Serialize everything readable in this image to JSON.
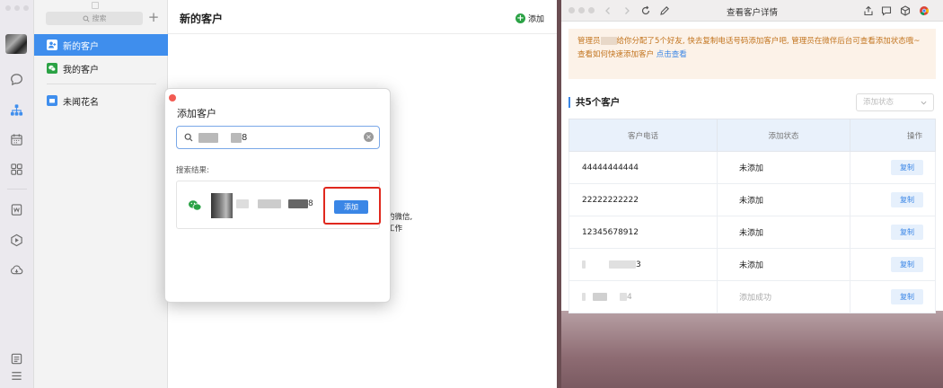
{
  "left_app": {
    "search": {
      "placeholder": "搜索"
    },
    "contact_list": {
      "items": [
        {
          "label": "新的客户",
          "active": true
        },
        {
          "label": "我的客户",
          "active": false
        },
        {
          "label": "未闻花名",
          "active": false
        }
      ]
    },
    "main": {
      "title": "新的客户",
      "add_label": "添加",
      "hint_line1": "的微信,",
      "hint_line2": "工作"
    },
    "dialog": {
      "title": "添加客户",
      "search_value_suffix": "8",
      "results_label": "搜索结果:",
      "result": {
        "name_suffix": "8"
      },
      "add_button": "添加"
    }
  },
  "right_app": {
    "title": "查看客户详情",
    "notice": {
      "line1_prefix": "管理员",
      "line1_rest": "给你分配了5个好友, 快去复制电话号码添加客户吧, 管理员在微伴后台可查看添加状态哦~",
      "line2": "查看如何快速添加客户",
      "link": "点击查看"
    },
    "count_title": "共5个客户",
    "status_select": {
      "placeholder": "添加状态"
    },
    "table": {
      "headers": [
        "客户电话",
        "添加状态",
        "操作"
      ],
      "rows": [
        {
          "phone": "44444444444",
          "status": "未添加",
          "action": "复制",
          "faded": false
        },
        {
          "phone": "22222222222",
          "status": "未添加",
          "action": "复制",
          "faded": false
        },
        {
          "phone": "12345678912",
          "status": "未添加",
          "action": "复制",
          "faded": false
        },
        {
          "phone_suffix": "3",
          "status": "未添加",
          "action": "复制",
          "faded": false
        },
        {
          "phone_suffix": "4",
          "status": "添加成功",
          "action": "复制",
          "faded": true
        }
      ]
    }
  },
  "colors": {
    "accent": "#3a86e6",
    "active_item": "#3f8eed",
    "wecom_green": "#2ba245",
    "highlight_red": "#e0281e",
    "notice_bg": "#fcf2e8",
    "notice_text": "#c2741e"
  },
  "icons": {
    "rail": [
      "avatar",
      "chat-icon",
      "contacts-icon",
      "calendar-icon",
      "apps-icon",
      "document-icon",
      "play-icon",
      "cloud-icon",
      "notes-icon",
      "menu-icon"
    ]
  }
}
